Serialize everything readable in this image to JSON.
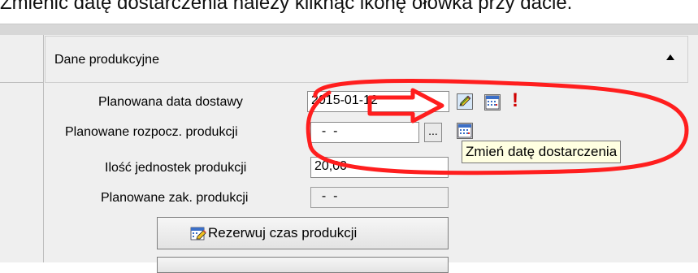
{
  "caption": "Zmienić datę dostarczenia należy kliknąć ikonę ołówka przy dacie.",
  "section": {
    "title": "Dane produkcyjne"
  },
  "fields": {
    "planned_delivery": {
      "label": "Planowana data dostawy",
      "value": "2015-01-12"
    },
    "planned_start": {
      "label": "Planowane rozpocz. produkcji",
      "value": "  -  -"
    },
    "units": {
      "label": "Ilość jednostek produkcji",
      "value": "20,00"
    },
    "planned_end": {
      "label": "Planowane zak. produkcji",
      "value": "  -  -"
    }
  },
  "ellipsis": "...",
  "tooltip": "Zmień datę dostarczenia",
  "reserve_button": {
    "label": "Rezerwuj czas produkcji"
  },
  "warning_mark": "!",
  "colors": {
    "annotation": "#ff1e1e",
    "tooltip_bg": "#ffffe1"
  },
  "icons": [
    "pencil-icon",
    "calendar-icon",
    "warning-icon",
    "collapse-arrow-icon",
    "reserve-time-icon"
  ]
}
